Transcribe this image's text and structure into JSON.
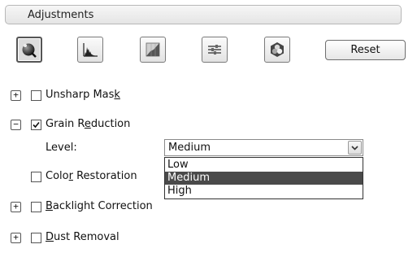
{
  "header": {
    "title": "Adjustments"
  },
  "toolbar": {
    "buttons": [
      {
        "icon": "auto-exposure-icon",
        "active": true
      },
      {
        "icon": "histogram-icon",
        "active": false
      },
      {
        "icon": "tone-curve-icon",
        "active": false
      },
      {
        "icon": "image-adjustment-sliders-icon",
        "active": false
      },
      {
        "icon": "color-palette-icon",
        "active": false
      }
    ],
    "reset_label": "Reset"
  },
  "options": {
    "unsharp_mask": {
      "label_pre": "Unsharp Mas",
      "label_key": "k",
      "label_post": "",
      "checked": false,
      "expander": "+"
    },
    "grain_reduction": {
      "label_pre": "Grain R",
      "label_key": "e",
      "label_post": "duction",
      "checked": true,
      "expander": "−"
    },
    "level": {
      "label": "Level:",
      "value": "Medium",
      "options": [
        "Low",
        "Medium",
        "High"
      ],
      "highlighted": "Medium"
    },
    "color_restoration": {
      "label_pre": "Colo",
      "label_key": "r",
      "label_post": " Restoration",
      "checked": false
    },
    "backlight_correction": {
      "label_pre": "",
      "label_key": "B",
      "label_post": "acklight Correction",
      "checked": false,
      "expander": "+"
    },
    "dust_removal": {
      "label_pre": "",
      "label_key": "D",
      "label_post": "ust Removal",
      "checked": false,
      "expander": "+"
    }
  }
}
